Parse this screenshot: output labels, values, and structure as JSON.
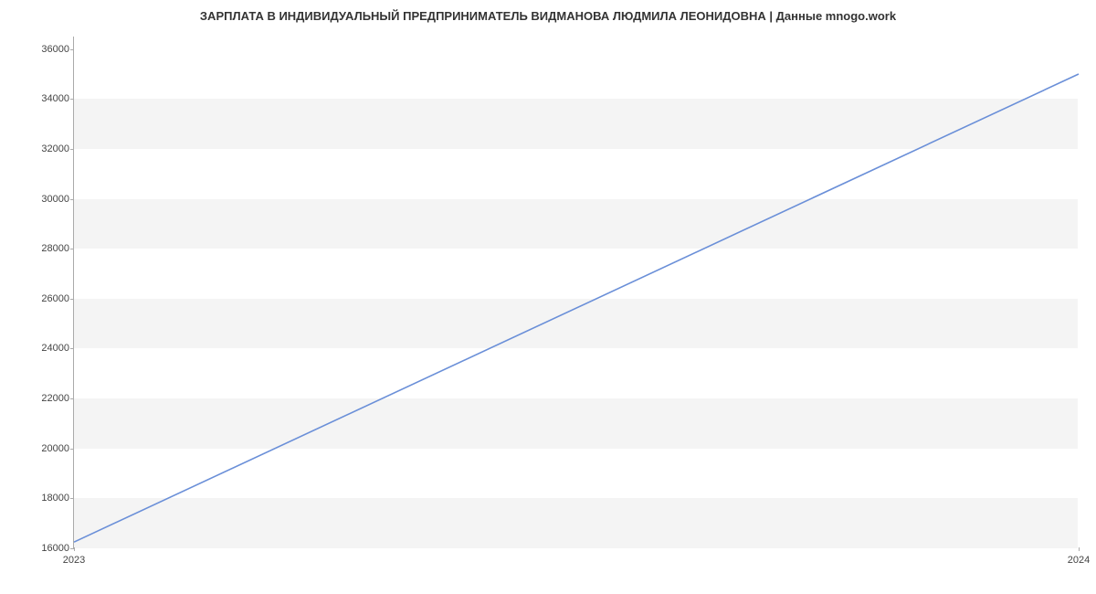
{
  "chart_data": {
    "type": "line",
    "title": "ЗАРПЛАТА В ИНДИВИДУАЛЬНЫЙ ПРЕДПРИНИМАТЕЛЬ ВИДМАНОВА ЛЮДМИЛА ЛЕОНИДОВНА | Данные mnogo.work",
    "x": [
      2023,
      2024
    ],
    "values": [
      16250,
      35000
    ],
    "xlabel": "",
    "ylabel": "",
    "x_ticks": [
      2023,
      2024
    ],
    "y_ticks": [
      16000,
      18000,
      20000,
      22000,
      24000,
      26000,
      28000,
      30000,
      32000,
      34000,
      36000
    ],
    "ylim": [
      16000,
      36500
    ],
    "line_color": "#6a8fd8"
  }
}
